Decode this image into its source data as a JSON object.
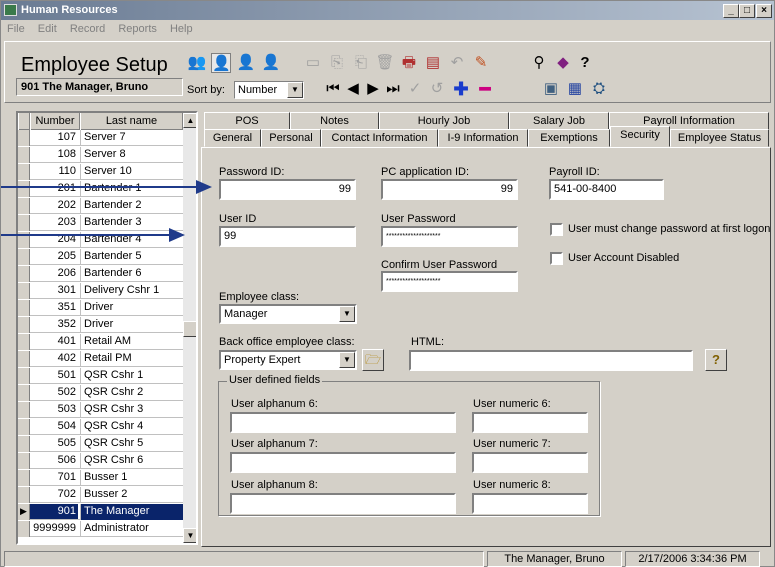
{
  "window": {
    "title": "Human Resources",
    "min": "_",
    "max": "□",
    "close": "×"
  },
  "menu": [
    "File",
    "Edit",
    "Record",
    "Reports",
    "Help"
  ],
  "header": {
    "page_title": "Employee Setup",
    "employee": "901  The Manager, Bruno",
    "sort_label": "Sort by:",
    "sort_value": "Number"
  },
  "list": {
    "headers": [
      "Number",
      "Last name"
    ],
    "rows": [
      {
        "num": "107",
        "name": "Server 7"
      },
      {
        "num": "108",
        "name": "Server 8"
      },
      {
        "num": "110",
        "name": "Server 10"
      },
      {
        "num": "201",
        "name": "Bartender 1"
      },
      {
        "num": "202",
        "name": "Bartender 2"
      },
      {
        "num": "203",
        "name": "Bartender 3"
      },
      {
        "num": "204",
        "name": "Bartender 4"
      },
      {
        "num": "205",
        "name": "Bartender 5"
      },
      {
        "num": "206",
        "name": "Bartender 6"
      },
      {
        "num": "301",
        "name": "Delivery Cshr 1"
      },
      {
        "num": "351",
        "name": "Driver"
      },
      {
        "num": "352",
        "name": "Driver"
      },
      {
        "num": "401",
        "name": "Retail AM"
      },
      {
        "num": "402",
        "name": "Retail PM"
      },
      {
        "num": "501",
        "name": "QSR Cshr 1"
      },
      {
        "num": "502",
        "name": "QSR Cshr 2"
      },
      {
        "num": "503",
        "name": "QSR Cshr 3"
      },
      {
        "num": "504",
        "name": "QSR Cshr 4"
      },
      {
        "num": "505",
        "name": "QSR Cshr 5"
      },
      {
        "num": "506",
        "name": "QSR Cshr 6"
      },
      {
        "num": "701",
        "name": "Busser 1"
      },
      {
        "num": "702",
        "name": "Busser 2"
      },
      {
        "num": "901",
        "name": "The Manager"
      },
      {
        "num": "9999999",
        "name": "Administrator"
      }
    ]
  },
  "tabs_row1": [
    "POS",
    "Notes",
    "Hourly Job",
    "Salary Job",
    "Payroll Information"
  ],
  "tabs_row2": [
    "General",
    "Personal",
    "Contact Information",
    "I-9 Information",
    "Exemptions",
    "Security",
    "Employee Status"
  ],
  "security": {
    "password_id_label": "Password ID:",
    "password_id": "99",
    "pc_app_id_label": "PC application ID:",
    "pc_app_id": "99",
    "payroll_id_label": "Payroll ID:",
    "payroll_id": "541-00-8400",
    "user_id_label": "User ID",
    "user_id": "99",
    "user_password_label": "User Password",
    "user_password": "********************",
    "confirm_password_label": "Confirm User Password",
    "confirm_password": "********************",
    "must_change_label": "User must change password at first logon",
    "disabled_label": "User Account Disabled",
    "emp_class_label": "Employee class:",
    "emp_class": "Manager",
    "back_office_label": "Back office employee class:",
    "back_office": "Property Expert",
    "html_label": "HTML:",
    "html": "",
    "udf_legend": "User defined fields",
    "alpha6": "User alphanum 6:",
    "num6": "User numeric 6:",
    "alpha7": "User alphanum 7:",
    "num7": "User numeric 7:",
    "alpha8": "User alphanum 8:",
    "num8": "User numeric 8:"
  },
  "status": {
    "user": "The Manager, Bruno",
    "datetime": "2/17/2006 3:34:36 PM"
  }
}
